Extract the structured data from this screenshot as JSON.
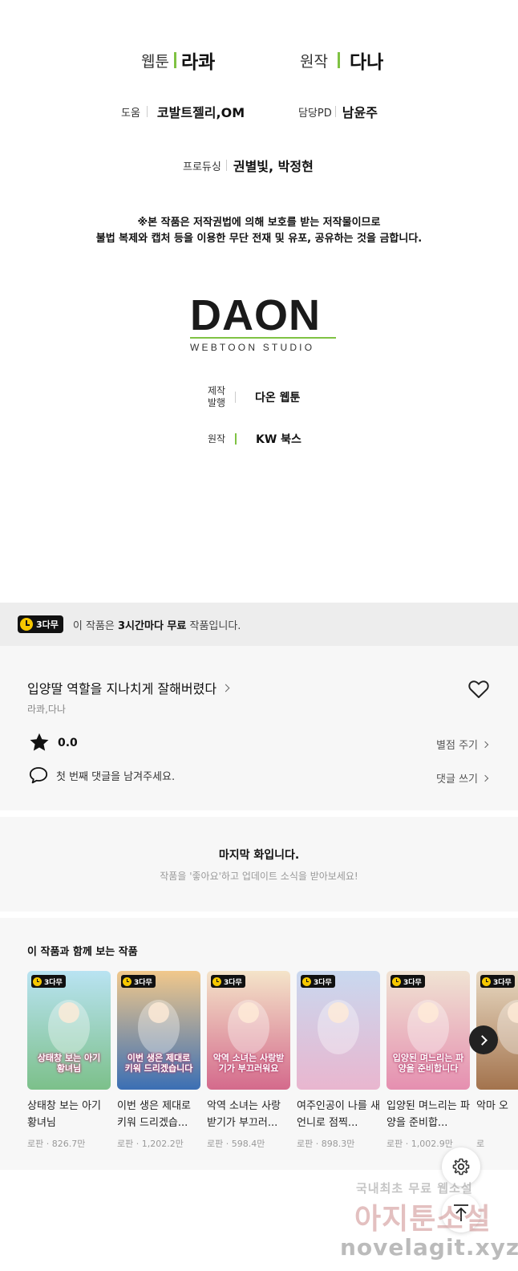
{
  "credits": {
    "webtoon_label": "웹툰",
    "webtoon_value": "라콰",
    "original_label": "원작",
    "original_value": "다나",
    "assist_label": "도움",
    "assist_value": "코발트젤리,OM",
    "pd_label": "담당PD",
    "pd_value": "남윤주",
    "producing_label": "프로듀싱",
    "producing_value": "권별빛, 박정현",
    "notice_line1": "※본 작품은 저작권법에 의해 보호를 받는 저작물이므로",
    "notice_line2": "불법 복제와 캡처 등을 이용한 무단 전재 및 유포, 공유하는 것을 금합니다.",
    "logo_main": "DAON",
    "logo_sub": "WEBTOON STUDIO",
    "prod_label_1": "제작",
    "prod_label_2": "발행",
    "prod_value": "다온 웹툰",
    "orig_pub_label": "원작",
    "orig_pub_value": "KW 북스"
  },
  "free_banner": {
    "badge": "3다무",
    "text_prefix": "이 작품은 ",
    "text_bold": "3시간마다 무료",
    "text_suffix": " 작품입니다."
  },
  "work": {
    "title": "입양딸 역할을 지나치게 잘해버렸다",
    "author": "라콰,다나",
    "rating": "0.0",
    "rate_link": "별점 주기",
    "comment_prompt": "첫 번째 댓글을 남겨주세요.",
    "comment_link": "댓글 쓰기"
  },
  "last_episode": {
    "title": "마지막 화입니다.",
    "subtitle": "작품을 '좋아요'하고 업데이트 소식을 받아보세요!"
  },
  "recommend": {
    "title": "이 작품과 함께 보는 작품",
    "badge": "3다무",
    "cards": [
      {
        "name": "상태창 보는 아기 황녀님",
        "meta": "로판 · 826.7만",
        "art_text": "상태창 보는 아기 황녀님",
        "color1": "#b9e3f2",
        "color2": "#7cc08a"
      },
      {
        "name": "이번 생은 제대로 키워 드리겠습...",
        "meta": "로판 · 1,202.2만",
        "art_text": "이번 생은 제대로 키워 드리겠습니다",
        "color1": "#f1c88b",
        "color2": "#3b6fb4"
      },
      {
        "name": "악역 소녀는 사랑 받기가 부끄러...",
        "meta": "로판 · 598.4만",
        "art_text": "악역 소녀는 사랑받기가 부끄러워요",
        "color1": "#f4e4c9",
        "color2": "#d46a8c"
      },
      {
        "name": "여주인공이 나를 새언니로 점찍...",
        "meta": "로판 · 898.3만",
        "art_text": "",
        "color1": "#c9d8ef",
        "color2": "#e9b6cf"
      },
      {
        "name": "입양된 며느리는 파양을 준비합...",
        "meta": "로판 · 1,002.9만",
        "art_text": "입양된 며느리는 파양을 준비합니다",
        "color1": "#f0e3d3",
        "color2": "#e58fb0"
      },
      {
        "name": "악마 오",
        "meta": "로",
        "art_text": "",
        "color1": "#e8d9c2",
        "color2": "#a3734d"
      }
    ]
  },
  "watermark": {
    "line1": "국내최초 무료 웹소설",
    "line2": "아지툰소설",
    "line3": "novelagit.xyz"
  },
  "colors": {
    "accent_green": "#7fc243",
    "badge_yellow": "#f6c700"
  }
}
